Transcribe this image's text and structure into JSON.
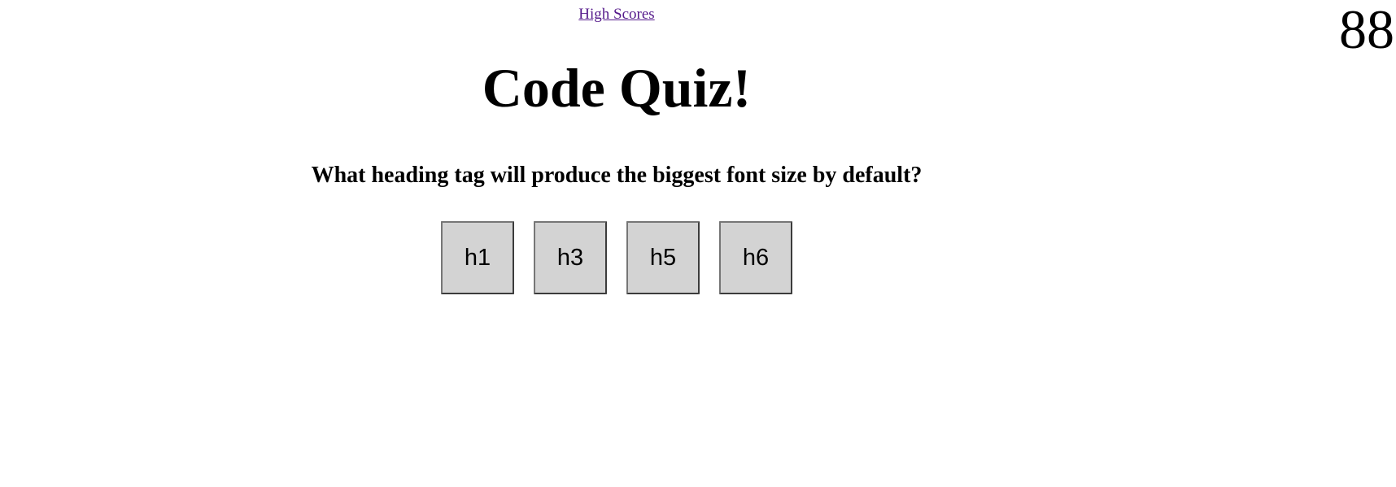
{
  "nav": {
    "high_scores_label": "High Scores"
  },
  "timer": {
    "value": "88"
  },
  "quiz": {
    "title": "Code Quiz!",
    "question": "What heading tag will produce the biggest font size by default?",
    "answers": [
      "h1",
      "h3",
      "h5",
      "h6"
    ]
  },
  "colors": {
    "link": "#551a8b",
    "button_bg": "#d3d3d3",
    "text": "#000000",
    "background": "#ffffff"
  }
}
